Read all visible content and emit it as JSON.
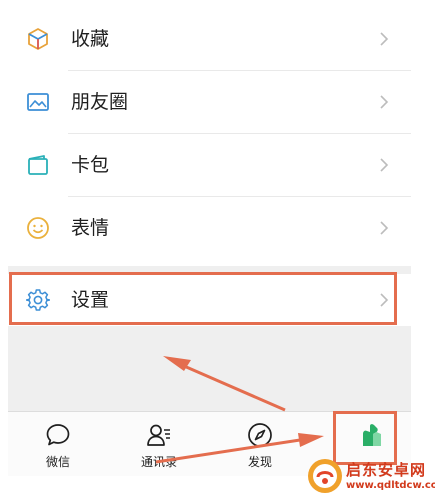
{
  "menu": {
    "items": [
      {
        "label": "收藏",
        "icon": "cube-icon"
      },
      {
        "label": "朋友圈",
        "icon": "photo-icon"
      },
      {
        "label": "卡包",
        "icon": "card-wallet-icon"
      },
      {
        "label": "表情",
        "icon": "smiley-icon"
      }
    ],
    "settings": {
      "label": "设置",
      "icon": "gear-icon"
    }
  },
  "tabbar": {
    "tabs": [
      {
        "label": "微信",
        "icon": "chat-bubble-icon"
      },
      {
        "label": "通讯录",
        "icon": "contacts-icon"
      },
      {
        "label": "发现",
        "icon": "compass-icon"
      },
      {
        "label": "",
        "icon": "me-icon"
      }
    ]
  },
  "watermark": {
    "name": "启东安卓网",
    "url": "www.qdltdcw.com"
  },
  "colors": {
    "annotation": "#e46d4e",
    "accent_green": "#2aae67",
    "icon_blue": "#3d8fd6"
  }
}
